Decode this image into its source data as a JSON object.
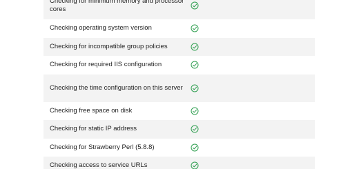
{
  "checks": [
    {
      "label": "Checking for minimum memory and processor cores",
      "status": "passed",
      "tall": true,
      "alt": true
    },
    {
      "label": "Checking operating system version",
      "status": "passed",
      "tall": false,
      "alt": false
    },
    {
      "label": "Checking for incompatible group policies",
      "status": "passed",
      "tall": false,
      "alt": true
    },
    {
      "label": "Checking for required IIS configuration",
      "status": "passed",
      "tall": false,
      "alt": false
    },
    {
      "label": "Checking the time configuration on this server",
      "status": "passed",
      "tall": true,
      "alt": true
    },
    {
      "label": "Checking free space on disk",
      "status": "passed",
      "tall": false,
      "alt": false
    },
    {
      "label": "Checking for static IP address",
      "status": "passed",
      "tall": false,
      "alt": true
    },
    {
      "label": "Checking for Strawberry Perl (5.8.8)",
      "status": "passed",
      "tall": false,
      "alt": false
    },
    {
      "label": "Checking access to service URLs",
      "status": "passed",
      "tall": false,
      "alt": true
    }
  ],
  "colors": {
    "success": "#2e9e4f",
    "row_alt": "#f3f3f3",
    "text": "#1f1f1f"
  },
  "icons": {
    "passed": "check-circle-icon"
  }
}
